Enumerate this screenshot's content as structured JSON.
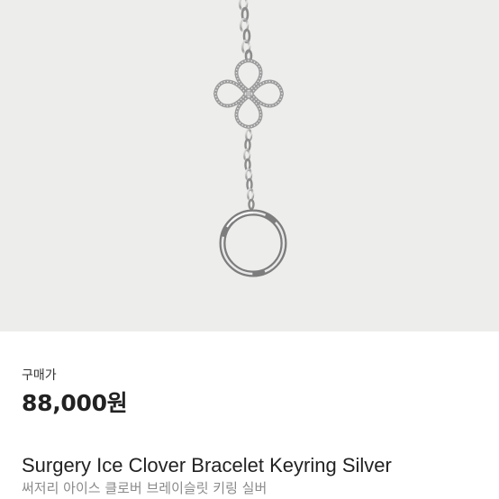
{
  "product": {
    "image_alt": "Surgery Ice Clover Bracelet Keyring Silver product photo",
    "price_label": "구매가",
    "price": "88,000원",
    "name": "Surgery Ice Clover Bracelet Keyring Silver",
    "name_ko": "써저리 아이스 클로버 브레이슬릿 키링 실버"
  }
}
